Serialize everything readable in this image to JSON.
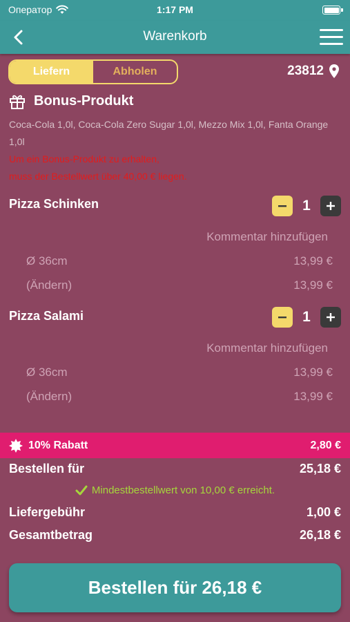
{
  "status": {
    "carrier": "Оператор",
    "time": "1:17 PM"
  },
  "nav": {
    "title": "Warenkorb"
  },
  "toggle": {
    "deliver": "Liefern",
    "pickup": "Abholen",
    "selected": "Liefern"
  },
  "location": {
    "zip": "23812"
  },
  "bonus": {
    "title": "Bonus-Produkt",
    "description": "Coca-Cola 1,0l, Coca-Cola Zero Sugar 1,0l, Mezzo Mix 1,0l, Fanta Orange 1,0l",
    "warning_line1": "Um ein Bonus-Produkt zu erhalten,",
    "warning_line2": "muss der Bestellwert über 40,00 € liegen."
  },
  "items": [
    {
      "name": "Pizza Schinken",
      "quantity": "1",
      "comment": "Kommentar hinzufügen",
      "options": [
        {
          "label": "Ø 36cm",
          "price": "13,99 €"
        },
        {
          "label": "(Ändern)",
          "price": "13,99 €"
        }
      ]
    },
    {
      "name": "Pizza Salami",
      "quantity": "1",
      "comment": "Kommentar hinzufügen",
      "options": [
        {
          "label": "Ø 36cm",
          "price": "13,99 €"
        },
        {
          "label": "(Ändern)",
          "price": "13,99 €"
        }
      ]
    }
  ],
  "discount": {
    "label": "10% Rabatt",
    "amount": "2,80 €"
  },
  "summary": {
    "order_for_label": "Bestellen für",
    "order_for_value": "25,18 €",
    "min_order_msg": "Mindestbestellwert von 10,00 € erreicht.",
    "delivery_fee_label": "Liefergebühr",
    "delivery_fee_value": "1,00 €",
    "total_label": "Gesamtbetrag",
    "total_value": "26,18 €"
  },
  "cta": {
    "label": "Bestellen für 26,18 €"
  },
  "colors": {
    "background": "#8c4560",
    "teal": "#3d9a9a",
    "yellow": "#f4d96b",
    "pink": "#e01d6f",
    "success": "#a6d63c",
    "warning": "#e21c1c"
  }
}
